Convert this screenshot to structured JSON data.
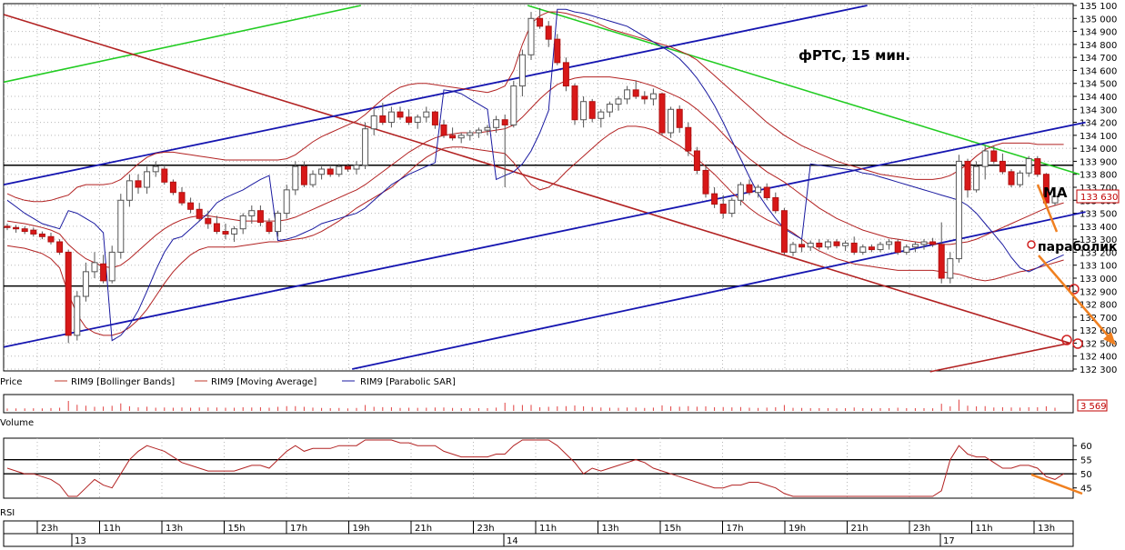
{
  "chart_data": {
    "type": "candlestick",
    "title": "фРТС,  15 мин.",
    "price_axis": {
      "min": 132300,
      "max": 135100,
      "step": 100,
      "ticks": [
        "132 300",
        "132 400",
        "132 500",
        "132 600",
        "132 700",
        "132 800",
        "132 900",
        "133 000",
        "133 100",
        "133 200",
        "133 300",
        "133 400",
        "133 500",
        "133 600",
        "133 700",
        "133 800",
        "133 900",
        "134 000",
        "134 100",
        "134 200",
        "134 300",
        "134 400",
        "134 500",
        "134 600",
        "134 700",
        "134 800",
        "134 900",
        "135 000",
        "135 100"
      ],
      "last_price": "133 630"
    },
    "legend": [
      {
        "label": "Price",
        "color": "#000000"
      },
      {
        "label": "RIM9 [Bollinger Bands]",
        "color": "#c0392b"
      },
      {
        "label": "RIM9 [Moving Average]",
        "color": "#c0392b"
      },
      {
        "label": "RIM9 [Parabolic SAR]",
        "color": "#1a1aa0"
      }
    ],
    "volume": {
      "label": "Volume",
      "last_value": "3 569"
    },
    "rsi": {
      "label": "RSI",
      "min": 42,
      "max": 62,
      "ticks": [
        45,
        50,
        55,
        60
      ],
      "levels": [
        55,
        50
      ]
    },
    "time_axis": {
      "hour_labels": [
        "23h",
        "11h",
        "13h",
        "15h",
        "17h",
        "19h",
        "21h",
        "23h",
        "11h",
        "13h",
        "15h",
        "17h",
        "19h",
        "21h",
        "23h",
        "11h",
        "13h"
      ],
      "day_labels": [
        "13",
        "14",
        "17"
      ]
    },
    "horizontal_levels": [
      133870,
      132940
    ],
    "annotations": [
      {
        "text": "MA"
      },
      {
        "text": "параболик"
      }
    ],
    "candles": [
      [
        133400,
        133420,
        133370,
        133390
      ],
      [
        133390,
        133410,
        133350,
        133380
      ],
      [
        133380,
        133400,
        133340,
        133360
      ],
      [
        133370,
        133390,
        133320,
        133340
      ],
      [
        133340,
        133360,
        133300,
        133320
      ],
      [
        133320,
        133350,
        133260,
        133280
      ],
      [
        133280,
        133300,
        133180,
        133200
      ],
      [
        133200,
        133220,
        132500,
        132560
      ],
      [
        132560,
        132900,
        132520,
        132860
      ],
      [
        132860,
        133120,
        132820,
        133050
      ],
      [
        133050,
        133200,
        133000,
        133120
      ],
      [
        133110,
        133180,
        132960,
        132980
      ],
      [
        132980,
        133250,
        132960,
        133200
      ],
      [
        133200,
        133650,
        133150,
        133600
      ],
      [
        133600,
        133800,
        133550,
        133750
      ],
      [
        133750,
        133800,
        133650,
        133700
      ],
      [
        133700,
        133860,
        133650,
        133820
      ],
      [
        133820,
        133900,
        133780,
        133860
      ],
      [
        133840,
        133860,
        133720,
        133740
      ],
      [
        133740,
        133760,
        133640,
        133660
      ],
      [
        133660,
        133700,
        133560,
        133580
      ],
      [
        133580,
        133620,
        133500,
        133530
      ],
      [
        133530,
        133580,
        133440,
        133460
      ],
      [
        133460,
        133520,
        133380,
        133420
      ],
      [
        133420,
        133480,
        133340,
        133360
      ],
      [
        133360,
        133420,
        133300,
        133340
      ],
      [
        133340,
        133400,
        133280,
        133380
      ],
      [
        133380,
        133500,
        133340,
        133480
      ],
      [
        133480,
        133560,
        133420,
        133520
      ],
      [
        133520,
        133560,
        133400,
        133430
      ],
      [
        133430,
        133460,
        133340,
        133360
      ],
      [
        133360,
        133520,
        133320,
        133500
      ],
      [
        133500,
        133720,
        133460,
        133680
      ],
      [
        133680,
        133900,
        133640,
        133860
      ],
      [
        133860,
        133900,
        133700,
        133720
      ],
      [
        133720,
        133830,
        133700,
        133800
      ],
      [
        133800,
        133860,
        133760,
        133840
      ],
      [
        133840,
        133860,
        133780,
        133800
      ],
      [
        133800,
        133880,
        133780,
        133860
      ],
      [
        133860,
        133880,
        133820,
        133840
      ],
      [
        133840,
        133900,
        133800,
        133870
      ],
      [
        133870,
        134200,
        133840,
        134150
      ],
      [
        134150,
        134300,
        134100,
        134250
      ],
      [
        134250,
        134350,
        134180,
        134200
      ],
      [
        134200,
        134320,
        134160,
        134280
      ],
      [
        134280,
        134320,
        134220,
        134240
      ],
      [
        134240,
        134300,
        134180,
        134200
      ],
      [
        134200,
        134260,
        134150,
        134240
      ],
      [
        134240,
        134320,
        134200,
        134280
      ],
      [
        134280,
        134290,
        134150,
        134180
      ],
      [
        134180,
        134220,
        134080,
        134100
      ],
      [
        134100,
        134160,
        134060,
        134080
      ],
      [
        134080,
        134120,
        134040,
        134100
      ],
      [
        134100,
        134140,
        134060,
        134120
      ],
      [
        134120,
        134160,
        134080,
        134140
      ],
      [
        134140,
        134180,
        134100,
        134160
      ],
      [
        134160,
        134250,
        134120,
        134220
      ],
      [
        134220,
        134260,
        133700,
        134180
      ],
      [
        134180,
        134520,
        134160,
        134480
      ],
      [
        134480,
        134760,
        134400,
        134720
      ],
      [
        134720,
        135050,
        134680,
        135000
      ],
      [
        135000,
        135080,
        134920,
        134940
      ],
      [
        134940,
        134980,
        134780,
        134840
      ],
      [
        134840,
        134880,
        134640,
        134660
      ],
      [
        134660,
        134700,
        134440,
        134480
      ],
      [
        134480,
        134500,
        134180,
        134220
      ],
      [
        134220,
        134400,
        134160,
        134360
      ],
      [
        134360,
        134380,
        134200,
        134230
      ],
      [
        134230,
        134300,
        134160,
        134280
      ],
      [
        134280,
        134360,
        134240,
        134340
      ],
      [
        134340,
        134400,
        134290,
        134380
      ],
      [
        134380,
        134480,
        134340,
        134450
      ],
      [
        134450,
        134520,
        134380,
        134400
      ],
      [
        134400,
        134440,
        134340,
        134380
      ],
      [
        134380,
        134460,
        134330,
        134420
      ],
      [
        134420,
        134430,
        134100,
        134120
      ],
      [
        134120,
        134320,
        134080,
        134300
      ],
      [
        134300,
        134330,
        134120,
        134160
      ],
      [
        134160,
        134200,
        133940,
        133980
      ],
      [
        133980,
        134010,
        133800,
        133830
      ],
      [
        133830,
        133860,
        133620,
        133650
      ],
      [
        133650,
        133700,
        133540,
        133570
      ],
      [
        133570,
        133640,
        133460,
        133500
      ],
      [
        133500,
        133620,
        133470,
        133600
      ],
      [
        133600,
        133740,
        133560,
        133720
      ],
      [
        133720,
        133760,
        133640,
        133660
      ],
      [
        133660,
        133720,
        133620,
        133700
      ],
      [
        133700,
        133730,
        133600,
        133620
      ],
      [
        133620,
        133660,
        133500,
        133520
      ],
      [
        133520,
        133540,
        133180,
        133200
      ],
      [
        133200,
        133280,
        133170,
        133260
      ],
      [
        133260,
        133300,
        133200,
        133240
      ],
      [
        133240,
        133290,
        133210,
        133270
      ],
      [
        133270,
        133300,
        133220,
        133240
      ],
      [
        133240,
        133300,
        133220,
        133280
      ],
      [
        133280,
        133300,
        133230,
        133250
      ],
      [
        133250,
        133290,
        133210,
        133270
      ],
      [
        133270,
        133320,
        133180,
        133200
      ],
      [
        133200,
        133260,
        133180,
        133240
      ],
      [
        133240,
        133260,
        133200,
        133220
      ],
      [
        133220,
        133280,
        133200,
        133260
      ],
      [
        133260,
        133300,
        133220,
        133280
      ],
      [
        133280,
        133300,
        133180,
        133200
      ],
      [
        133200,
        133260,
        133180,
        133240
      ],
      [
        133240,
        133280,
        133200,
        133260
      ],
      [
        133260,
        133300,
        133220,
        133280
      ],
      [
        133280,
        133310,
        133240,
        133260
      ],
      [
        133260,
        133430,
        132960,
        133000
      ],
      [
        133000,
        133200,
        132960,
        133150
      ],
      [
        133150,
        133950,
        133120,
        133900
      ],
      [
        133900,
        133920,
        133620,
        133680
      ],
      [
        133680,
        133900,
        133660,
        133860
      ],
      [
        133860,
        134020,
        133760,
        133980
      ],
      [
        133980,
        134020,
        133880,
        133900
      ],
      [
        133900,
        133960,
        133800,
        133820
      ],
      [
        133820,
        133840,
        133700,
        133720
      ],
      [
        133720,
        133830,
        133700,
        133810
      ],
      [
        133810,
        133940,
        133780,
        133920
      ],
      [
        133920,
        133940,
        133780,
        133800
      ],
      [
        133800,
        133810,
        133560,
        133580
      ],
      [
        133580,
        133680,
        133560,
        133630
      ]
    ],
    "moving_average": [
      133440,
      133430,
      133420,
      133405,
      133390,
      133370,
      133340,
      133260,
      133200,
      133150,
      133120,
      133090,
      133080,
      133100,
      133150,
      133210,
      133270,
      133330,
      133380,
      133420,
      133450,
      133470,
      133480,
      133480,
      133470,
      133460,
      133450,
      133440,
      133440,
      133440,
      133440,
      133440,
      133450,
      133470,
      133500,
      133530,
      133560,
      133590,
      133620,
      133650,
      133680,
      133720,
      133770,
      133820,
      133870,
      133920,
      133970,
      134010,
      134050,
      134080,
      134100,
      134110,
      134120,
      134120,
      134120,
      134130,
      134140,
      134150,
      134180,
      134240,
      134310,
      134380,
      134440,
      134490,
      134520,
      134540,
      134550,
      134550,
      134550,
      134550,
      134540,
      134530,
      134520,
      134500,
      134480,
      134450,
      134420,
      134390,
      134350,
      134300,
      134240,
      134180,
      134110,
      134040,
      133980,
      133920,
      133870,
      133820,
      133780,
      133740,
      133690,
      133640,
      133590,
      133540,
      133500,
      133460,
      133430,
      133400,
      133370,
      133350,
      133330,
      133310,
      133300,
      133290,
      133280,
      133270,
      133270,
      133260,
      133260,
      133270,
      133280,
      133300,
      133330,
      133360,
      133390,
      133420,
      133450,
      133480,
      133510,
      133540,
      133560,
      133580
    ],
    "bollinger_upper": [
      133650,
      133620,
      133600,
      133590,
      133590,
      133600,
      133620,
      133640,
      133700,
      133720,
      133720,
      133720,
      133730,
      133760,
      133820,
      133880,
      133930,
      133960,
      133970,
      133970,
      133960,
      133950,
      133940,
      133930,
      133920,
      133910,
      133910,
      133910,
      133910,
      133910,
      133910,
      133910,
      133920,
      133950,
      134000,
      134050,
      134090,
      134120,
      134150,
      134180,
      134210,
      134260,
      134320,
      134380,
      134430,
      134470,
      134490,
      134500,
      134500,
      134490,
      134480,
      134470,
      134460,
      134450,
      134440,
      134430,
      134450,
      134480,
      134600,
      134800,
      134960,
      135020,
      135050,
      135050,
      135040,
      135020,
      135000,
      134980,
      134950,
      134920,
      134900,
      134880,
      134860,
      134840,
      134820,
      134800,
      134780,
      134750,
      134720,
      134680,
      134620,
      134560,
      134500,
      134440,
      134380,
      134320,
      134260,
      134200,
      134150,
      134100,
      134060,
      134020,
      133990,
      133960,
      133930,
      133900,
      133880,
      133860,
      133840,
      133820,
      133800,
      133790,
      133780,
      133770,
      133760,
      133760,
      133760,
      133770,
      133790,
      133830,
      133880,
      133940,
      133990,
      134020,
      134040,
      134040,
      134040,
      134040,
      134030,
      134030,
      134030,
      134030
    ],
    "bollinger_lower": [
      133250,
      133240,
      133230,
      133210,
      133190,
      133150,
      133080,
      132880,
      132720,
      132620,
      132580,
      132560,
      132560,
      132580,
      132620,
      132680,
      132760,
      132860,
      132960,
      133050,
      133120,
      133180,
      133220,
      133240,
      133240,
      133240,
      133240,
      133250,
      133260,
      133270,
      133280,
      133280,
      133290,
      133300,
      133310,
      133330,
      133360,
      133400,
      133440,
      133490,
      133540,
      133580,
      133620,
      133660,
      133700,
      133760,
      133820,
      133880,
      133930,
      133970,
      134000,
      134010,
      134010,
      134000,
      133990,
      133980,
      133970,
      133960,
      133890,
      133800,
      133720,
      133680,
      133700,
      133750,
      133820,
      133880,
      133940,
      134000,
      134060,
      134110,
      134150,
      134170,
      134170,
      134160,
      134140,
      134100,
      134060,
      134020,
      133970,
      133920,
      133860,
      133800,
      133730,
      133660,
      133600,
      133540,
      133490,
      133450,
      133420,
      133390,
      133350,
      133300,
      133250,
      133210,
      133180,
      133150,
      133130,
      133110,
      133100,
      133090,
      133080,
      133070,
      133060,
      133060,
      133060,
      133060,
      133060,
      133050,
      133040,
      133030,
      133010,
      132990,
      132980,
      132990,
      133010,
      133030,
      133050,
      133060,
      133080,
      133100,
      133120,
      133140
    ],
    "parabolic_sar": [
      133600,
      133550,
      133500,
      133460,
      133420,
      133400,
      133380,
      133520,
      133500,
      133460,
      133420,
      133350,
      132520,
      132560,
      132640,
      132750,
      132900,
      133060,
      133200,
      133300,
      133320,
      133380,
      133440,
      133500,
      133580,
      133620,
      133650,
      133680,
      133720,
      133760,
      133790,
      133290,
      133300,
      133320,
      133350,
      133380,
      133420,
      133440,
      133460,
      133480,
      133500,
      133540,
      133600,
      133660,
      133720,
      133760,
      133800,
      133830,
      133860,
      133890,
      134450,
      134440,
      134420,
      134380,
      134340,
      134300,
      133760,
      133790,
      133820,
      133880,
      133980,
      134120,
      134290,
      135070,
      135070,
      135050,
      135040,
      135020,
      135000,
      134980,
      134960,
      134940,
      134900,
      134860,
      134820,
      134780,
      134740,
      134690,
      134620,
      134540,
      134440,
      134330,
      134200,
      134060,
      133920,
      133780,
      133650,
      133550,
      133460,
      133380,
      133340,
      133300,
      133880,
      133870,
      133860,
      133850,
      133840,
      133830,
      133810,
      133800,
      133780,
      133760,
      133740,
      133720,
      133700,
      133680,
      133660,
      133640,
      133620,
      133600,
      133560,
      133500,
      133420,
      133340,
      133260,
      133160,
      133080,
      133050,
      133080,
      133120,
      133150,
      133180
    ],
    "rsi_values": [
      52,
      51,
      50,
      50,
      49,
      48,
      46,
      35,
      40,
      45,
      48,
      46,
      45,
      50,
      55,
      58,
      60,
      59,
      58,
      56,
      54,
      53,
      52,
      51,
      51,
      51,
      51,
      52,
      53,
      53,
      52,
      55,
      58,
      60,
      58,
      59,
      59,
      59,
      60,
      60,
      60,
      62,
      63,
      62,
      62,
      61,
      61,
      60,
      60,
      60,
      58,
      57,
      56,
      56,
      56,
      56,
      57,
      57,
      60,
      63,
      66,
      64,
      62,
      60,
      57,
      54,
      50,
      52,
      51,
      52,
      53,
      54,
      55,
      54,
      52,
      51,
      50,
      49,
      48,
      47,
      46,
      45,
      45,
      46,
      46,
      47,
      47,
      46,
      45,
      43,
      42,
      42,
      42,
      42,
      42,
      42,
      42,
      42,
      42,
      42,
      42,
      42,
      42,
      42,
      42,
      42,
      36,
      44,
      55,
      60,
      57,
      56,
      56,
      54,
      52,
      52,
      53,
      53,
      52,
      49,
      48,
      50
    ]
  }
}
